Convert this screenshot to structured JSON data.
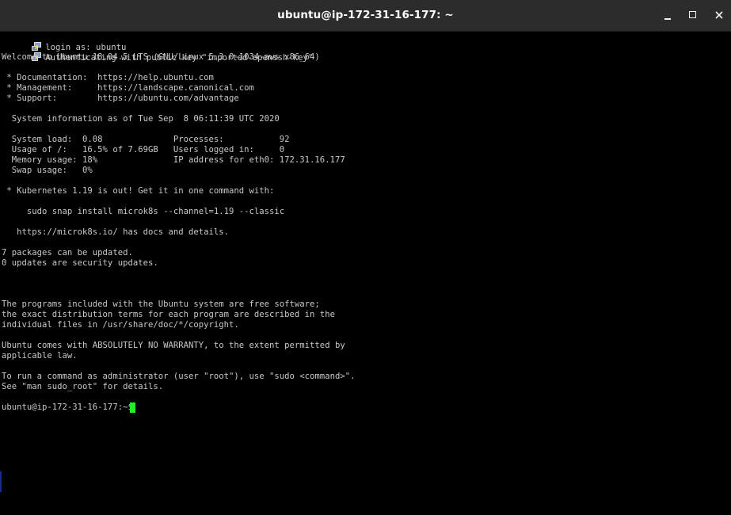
{
  "window": {
    "title": "ubuntu@ip-172-31-16-177: ~",
    "controls": {
      "minimize_icon": "minimize-icon",
      "maximize_icon": "maximize-icon",
      "close_icon": "close-icon"
    }
  },
  "terminal": {
    "colors": {
      "background": "#000000",
      "foreground": "#c9c9c9",
      "cursor": "#22ee22",
      "titlebar": "#2c2c2c"
    },
    "lines": {
      "login": "login as: ubuntu",
      "auth": "Authenticating with public key \"imported-openssh-key\"",
      "welcome": "Welcome to Ubuntu 18.04.5 LTS (GNU/Linux 5.3.0-1034-aws x86_64)",
      "doc": " * Documentation:  https://help.ubuntu.com",
      "mgmt": " * Management:     https://landscape.canonical.com",
      "support": " * Support:        https://ubuntu.com/advantage",
      "sysinfo": "  System information as of Tue Sep  8 06:11:39 UTC 2020",
      "sysload": "  System load:  0.08              Processes:           92",
      "usage": "  Usage of /:   16.5% of 7.69GB   Users logged in:     0",
      "memory": "  Memory usage: 18%               IP address for eth0: 172.31.16.177",
      "swap": "  Swap usage:   0%",
      "k8s": " * Kubernetes 1.19 is out! Get it in one command with:",
      "snap": "     sudo snap install microk8s --channel=1.19 --classic",
      "docs": "   https://microk8s.io/ has docs and details.",
      "pkgs": "7 packages can be updated.",
      "security": "0 updates are security updates.",
      "free1": "The programs included with the Ubuntu system are free software;",
      "free2": "the exact distribution terms for each program are described in the",
      "free3": "individual files in /usr/share/doc/*/copyright.",
      "warranty1": "Ubuntu comes with ABSOLUTELY NO WARRANTY, to the extent permitted by",
      "warranty2": "applicable law.",
      "root1": "To run a command as administrator (user \"root\"), use \"sudo <command>\".",
      "root2": "See \"man sudo_root\" for details.",
      "prompt": "ubuntu@ip-172-31-16-177:~$ "
    }
  }
}
